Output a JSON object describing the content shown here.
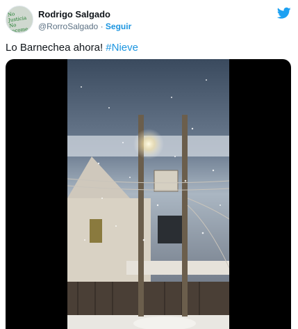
{
  "author": {
    "name": "Rodrigo Salgado",
    "handle": "@RorroSalgado",
    "separator": "·",
    "follow_label": "Seguir"
  },
  "tweet": {
    "text": "Lo Barnechea ahora! ",
    "hashtag": "#Nieve"
  },
  "icons": {
    "brand": "twitter-bird-icon",
    "brand_color": "#1da1f2"
  }
}
